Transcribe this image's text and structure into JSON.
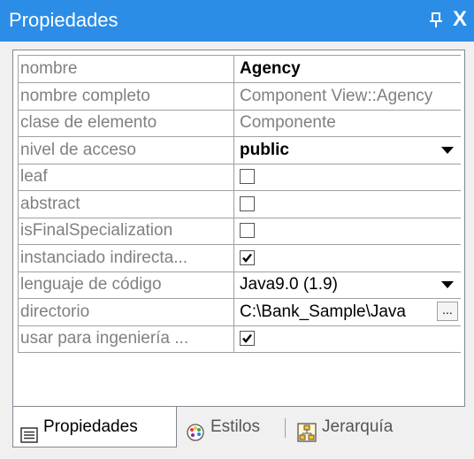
{
  "panel": {
    "title": "Propiedades",
    "pin_icon": "pin-icon",
    "close_glyph": "X"
  },
  "properties": [
    {
      "name": "nombre",
      "value": "Agency",
      "style": "bold",
      "control": "text"
    },
    {
      "name": "nombre completo",
      "value": "Component View::Agency",
      "style": "gray",
      "control": "text"
    },
    {
      "name": "clase de elemento",
      "value": "Componente",
      "style": "gray",
      "control": "text"
    },
    {
      "name": "nivel de acceso",
      "value": "public",
      "style": "bold",
      "control": "dropdown"
    },
    {
      "name": "leaf",
      "checked": false,
      "control": "checkbox"
    },
    {
      "name": "abstract",
      "checked": false,
      "control": "checkbox"
    },
    {
      "name": "isFinalSpecialization",
      "checked": false,
      "control": "checkbox"
    },
    {
      "name": "instanciado indirecta...",
      "checked": true,
      "control": "checkbox"
    },
    {
      "name": "lenguaje de código",
      "value": "Java9.0 (1.9)",
      "style": "plain",
      "control": "dropdown"
    },
    {
      "name": "directorio",
      "value": "C:\\Bank_Sample\\Java",
      "style": "plain",
      "control": "browse",
      "browse_label": "..."
    },
    {
      "name": "usar para ingeniería ...",
      "checked": true,
      "control": "checkbox"
    }
  ],
  "tabs": [
    {
      "label": "Propiedades",
      "icon": "properties-icon",
      "active": true
    },
    {
      "label": "Estilos",
      "icon": "palette-icon",
      "active": false
    },
    {
      "label": "Jerarquía",
      "icon": "hierarchy-icon",
      "active": false
    }
  ],
  "colors": {
    "titlebar": "#2b8de6",
    "name_text": "#808080",
    "grid_line": "#a0a0a0"
  }
}
